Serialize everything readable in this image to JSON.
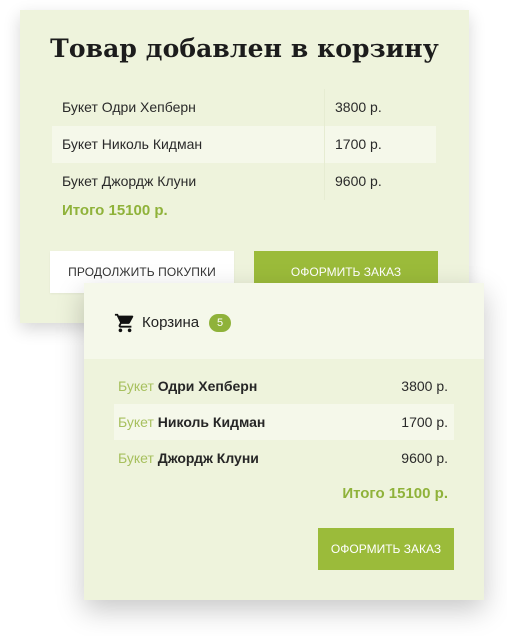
{
  "added_panel": {
    "title": "Товар добавлен в корзину",
    "items": [
      {
        "name": "Букет Одри Хепберн",
        "price": "3800 р."
      },
      {
        "name": "Букет Николь Кидман",
        "price": "1700 р."
      },
      {
        "name": "Букет Джордж Клуни",
        "price": "9600 р."
      }
    ],
    "total": "Итого 15100 р.",
    "continue_label": "Продолжить покупки",
    "order_label": "Оформить заказ"
  },
  "cart_panel": {
    "icon": "shopping-cart-icon",
    "title": "Корзина",
    "count": "5",
    "items": [
      {
        "prefix": "Букет",
        "name": "Одри Хепберн",
        "price": "3800 р."
      },
      {
        "prefix": "Букет",
        "name": "Николь Кидман",
        "price": "1700 р."
      },
      {
        "prefix": "Букет",
        "name": "Джордж Клуни",
        "price": "9600 р."
      }
    ],
    "total": "Итого 15100 р.",
    "order_label": "Оформить заказ"
  },
  "colors": {
    "panel_bg": "#eef3dc",
    "stripe_bg": "#f5f8ea",
    "accent": "#9bbb3a",
    "accent_text": "#8fb23a"
  }
}
